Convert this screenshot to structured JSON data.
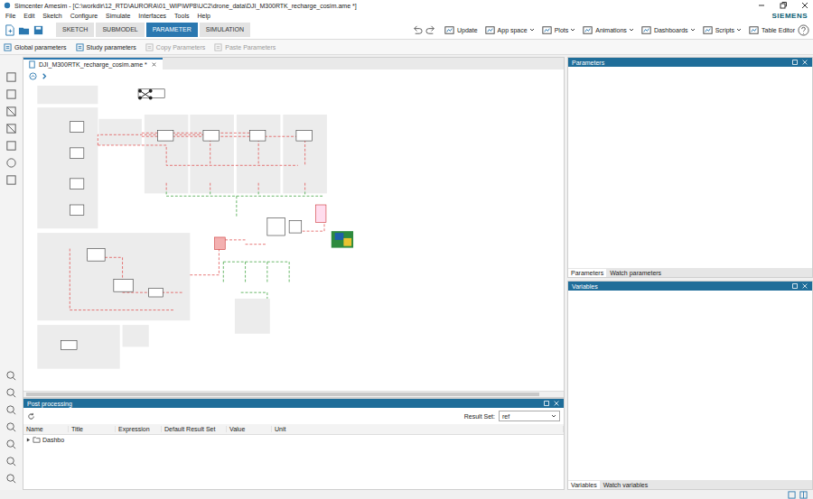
{
  "window": {
    "title": "Simcenter Amesim - [C:\\workdir\\12_RTD\\AURORA\\01_WIP\\WP8\\UC2\\drone_data\\DJI_M300RTK_recharge_cosim.ame *]"
  },
  "menu": [
    "File",
    "Edit",
    "Sketch",
    "Configure",
    "Simulate",
    "Interfaces",
    "Tools",
    "Help"
  ],
  "brand": "SIEMENS",
  "ribbon_tabs": [
    {
      "label": "SKETCH",
      "selected": false
    },
    {
      "label": "SUBMODEL",
      "selected": false
    },
    {
      "label": "PARAMETER",
      "selected": true
    },
    {
      "label": "SIMULATION",
      "selected": false
    }
  ],
  "ribbon_actions": [
    {
      "label": "Update",
      "dropdown": false
    },
    {
      "label": "App space",
      "dropdown": true
    },
    {
      "label": "Plots",
      "dropdown": true
    },
    {
      "label": "Animations",
      "dropdown": true
    },
    {
      "label": "Dashboards",
      "dropdown": true
    },
    {
      "label": "Scripts",
      "dropdown": true
    },
    {
      "label": "Table Editor",
      "dropdown": false
    }
  ],
  "subtoolbar": [
    {
      "label": "Global parameters",
      "disabled": false
    },
    {
      "label": "Study parameters",
      "disabled": false
    },
    {
      "label": "Copy Parameters",
      "disabled": true
    },
    {
      "label": "Paste Parameters",
      "disabled": true
    }
  ],
  "document_tab": {
    "label": "DJI_M300RTK_recharge_cosim.ame *",
    "selected": true
  },
  "parameters_panel": {
    "title": "Parameters",
    "tabs": [
      {
        "label": "Parameters",
        "selected": true
      },
      {
        "label": "Watch parameters",
        "selected": false
      }
    ]
  },
  "variables_panel": {
    "title": "Variables",
    "tabs": [
      {
        "label": "Variables",
        "selected": true
      },
      {
        "label": "Watch variables",
        "selected": false
      }
    ]
  },
  "post_processing": {
    "title": "Post processing",
    "result_set_label": "Result Set:",
    "result_set": "ref",
    "columns": [
      "Name",
      "Title",
      "Expression",
      "Default Result Set",
      "Value",
      "Unit"
    ],
    "rows": [
      {
        "name": "Dashbo",
        "expanded": false
      }
    ]
  }
}
